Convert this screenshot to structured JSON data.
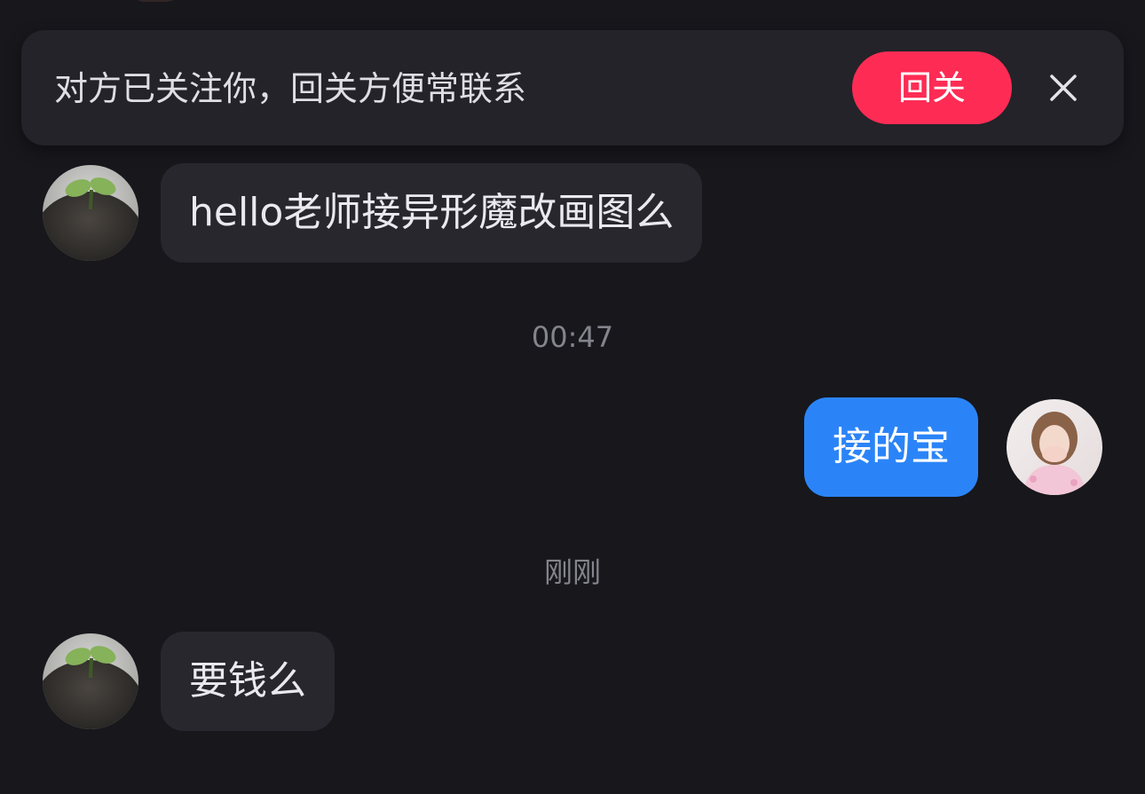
{
  "follow_banner": {
    "text": "对方已关注你，回关方便常联系",
    "button_label": "回关",
    "close_icon": "close-icon",
    "button_color": "#fe2c55"
  },
  "messages": [
    {
      "type": "incoming",
      "text": "hello老师接异形魔改画图么",
      "avatar": "sprout-hair-avatar"
    },
    {
      "type": "timestamp",
      "text": "00:47"
    },
    {
      "type": "outgoing",
      "text": "接的宝",
      "avatar": "girl-photo-avatar",
      "bubble_color": "#2b84f7"
    },
    {
      "type": "timestamp",
      "text": "刚刚"
    },
    {
      "type": "incoming",
      "text": "要钱么",
      "avatar": "sprout-hair-avatar"
    }
  ],
  "theme": {
    "background": "#17171c",
    "incoming_bubble": "#27272d"
  }
}
